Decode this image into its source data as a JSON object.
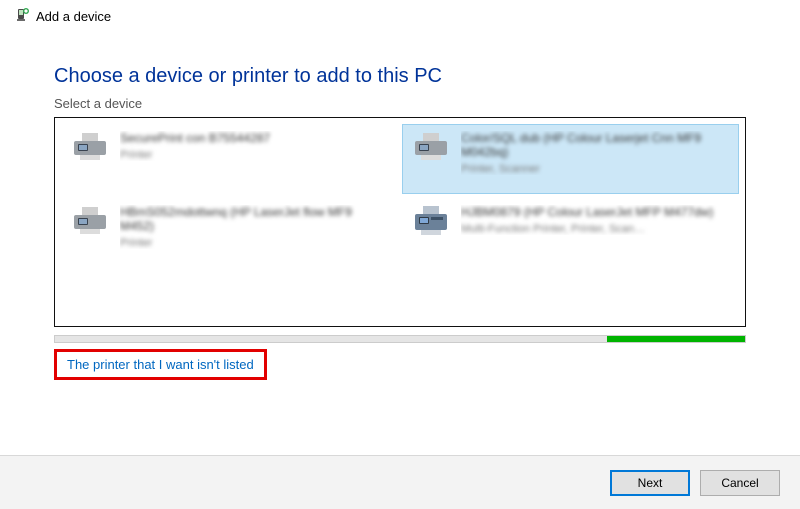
{
  "title": "Add a device",
  "heading": "Choose a device or printer to add to this PC",
  "subheading": "Select a device",
  "devices": [
    {
      "name": "SecurePrint con B75544287",
      "type": "Printer",
      "selected": false,
      "icon": "printer-gray"
    },
    {
      "name": "Color/SQL dub (HP Colour Laserjet Cnn MF9 M042bq)",
      "type": "Printer, Scanner",
      "selected": true,
      "icon": "printer-gray"
    },
    {
      "name": "HBmS052mdottwnq (HP LaserJet flow MF9 M452)",
      "type": "Printer",
      "selected": false,
      "icon": "printer-gray"
    },
    {
      "name": "HJBM0879 (HP Colour LaserJet MFP M477dw)",
      "type": "Multi-Function Printer, Printer, Scan…",
      "selected": false,
      "icon": "printer-blue"
    }
  ],
  "progress": {
    "indeterminate": true
  },
  "not_listed_link": "The printer that I want isn't listed",
  "buttons": {
    "next": "Next",
    "cancel": "Cancel"
  }
}
